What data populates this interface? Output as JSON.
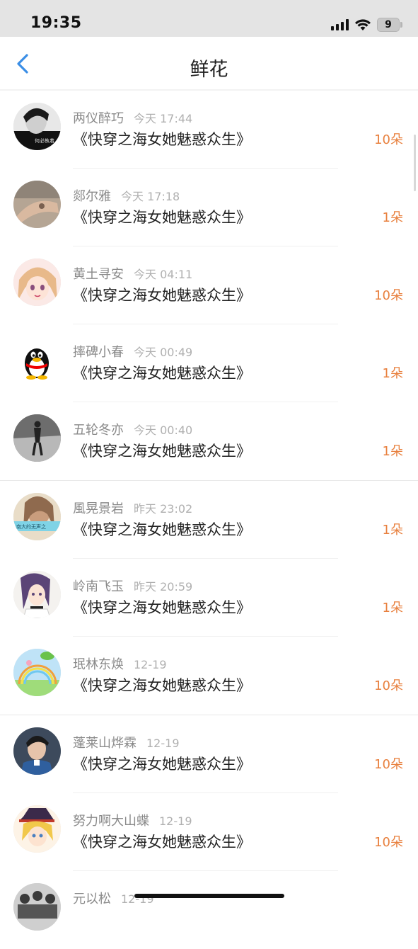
{
  "status_bar": {
    "time": "19:35",
    "battery": "9"
  },
  "nav": {
    "title": "鲜花",
    "back_icon": "chevron-left-icon",
    "accent_color": "#3a8ee6"
  },
  "colors": {
    "count": "#e8803e",
    "name": "#8a8a8a",
    "time": "#b0b0b0"
  },
  "items": [
    {
      "name": "两仪醉巧",
      "time": "今天 17:44",
      "book": "《快穿之海女她魅惑众生》",
      "count": "10朵",
      "avatar": "avatar-dark-portrait"
    },
    {
      "name": "郯尔雅",
      "time": "今天 17:18",
      "book": "《快穿之海女她魅惑众生》",
      "count": "1朵",
      "avatar": "avatar-hand-photo"
    },
    {
      "name": "黄土寻安",
      "time": "今天 04:11",
      "book": "《快穿之海女她魅惑众生》",
      "count": "10朵",
      "avatar": "avatar-anime-girl"
    },
    {
      "name": "摔碑小春",
      "time": "今天 00:49",
      "book": "《快穿之海女她魅惑众生》",
      "count": "1朵",
      "avatar": "avatar-penguin"
    },
    {
      "name": "五轮冬亦",
      "time": "今天 00:40",
      "book": "《快穿之海女她魅惑众生》",
      "count": "1朵",
      "avatar": "avatar-bw-figure"
    },
    {
      "name": "風晃景岩",
      "time": "昨天 23:02",
      "book": "《快穿之海女她魅惑众生》",
      "count": "1朵",
      "avatar": "avatar-blurred-girl"
    },
    {
      "name": "岭南飞玉",
      "time": "昨天 20:59",
      "book": "《快穿之海女她魅惑众生》",
      "count": "1朵",
      "avatar": "avatar-anime-purple"
    },
    {
      "name": "珉林东焕",
      "time": "12-19",
      "book": "《快穿之海女她魅惑众生》",
      "count": "10朵",
      "avatar": "avatar-sky-rainbow"
    },
    {
      "name": "蓬莱山烨霖",
      "time": "12-19",
      "book": "《快穿之海女她魅惑众生》",
      "count": "10朵",
      "avatar": "avatar-young-man"
    },
    {
      "name": "努力啊大山蝶",
      "time": "12-19",
      "book": "《快穿之海女她魅惑众生》",
      "count": "10朵",
      "avatar": "avatar-anime-hat"
    },
    {
      "name": "元以松",
      "time": "12-19",
      "book": "",
      "count": "",
      "avatar": "avatar-group-photo"
    }
  ]
}
